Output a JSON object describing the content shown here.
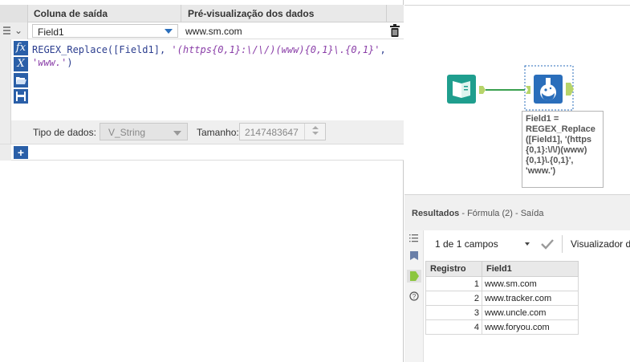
{
  "formula_grid": {
    "col_output": "Coluna de saída",
    "col_preview": "Pré-visualização dos dados",
    "field_selected": "Field1",
    "preview_value": "www.sm.com"
  },
  "expression": {
    "func": "REGEX_Replace",
    "open": "(",
    "arg_field": "[Field1]",
    "sep1": ", ",
    "pattern": "'(https{0,1}:\\/\\/)(www){0,1}\\.{0,1}'",
    "sep2": ",",
    "replacement": "'www.'",
    "close": ")"
  },
  "toolbar_icons": [
    "fx-icon",
    "variable-x-icon",
    "folder-open-icon",
    "save-icon"
  ],
  "type_row": {
    "datatype_label": "Tipo de dados:",
    "datatype_value": "V_String",
    "size_label": "Tamanho:",
    "size_value": "2147483647"
  },
  "canvas": {
    "annotation": "Field1 =\nREGEX_Replace\n([Field1], '(https\n{0,1}:\\/\\/)(www)\n{0,1}\\.{0,1}',\n'www.')",
    "colors": {
      "input_tool": "#1f9e8e",
      "formula_tool": "#2a6ebb",
      "connector": "#3aa050",
      "anchor": "#b7d46a"
    }
  },
  "results": {
    "title_bold": "Resultados",
    "title_rest": " - Fórmula (2) - Saída",
    "fields_count": "1 de 1 campos",
    "viewer_label": "Visualizador de célu",
    "columns": [
      "Registro",
      "Field1"
    ],
    "rows": [
      {
        "n": "1",
        "v": "www.sm.com"
      },
      {
        "n": "2",
        "v": "www.tracker.com"
      },
      {
        "n": "3",
        "v": "www.uncle.com"
      },
      {
        "n": "4",
        "v": "www.foryou.com"
      }
    ]
  }
}
